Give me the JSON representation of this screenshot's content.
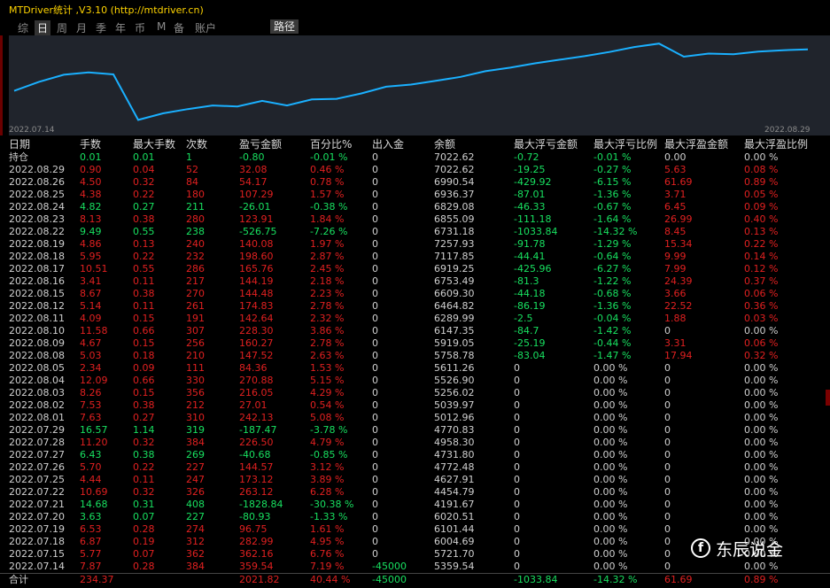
{
  "window": {
    "title": "MTDriver统计 ,V3.10 (http://mtdriver.cn)"
  },
  "tabs": [
    "综",
    "日",
    "周",
    "月",
    "季",
    "年",
    "币",
    "M",
    "备",
    "账户"
  ],
  "active_tab": "日",
  "path_button": "路径",
  "chart": {
    "x_start": "2022.07.14",
    "x_end": "2022.08.29",
    "line_color": "#1ab0ff",
    "balance": [
      5359.54,
      5721.7,
      6004.69,
      6101.44,
      6020.51,
      4191.67,
      4454.79,
      4627.91,
      4772.48,
      4731.8,
      4958.3,
      4770.83,
      5012.96,
      5039.97,
      5256.02,
      5526.9,
      5611.26,
      5758.78,
      5919.05,
      6147.35,
      6289.99,
      6464.82,
      6609.3,
      6753.49,
      6919.25,
      7117.85,
      7257.93,
      6731.18,
      6855.09,
      6829.08,
      6936.37,
      6990.54,
      7022.62
    ]
  },
  "columns": [
    "日期",
    "手数",
    "最大手数",
    "次数",
    "盈亏金额",
    "百分比%",
    "出入金",
    "余额",
    "最大浮亏金额",
    "最大浮亏比例",
    "最大浮盈金额",
    "最大浮盈比例"
  ],
  "holding": {
    "date": "持仓",
    "lots": "0.01",
    "max_lots": "0.01",
    "count": "1",
    "pnl": "-0.80",
    "pct": "-0.01 %",
    "flow": "0",
    "balance": "7022.62",
    "max_dd": "-0.72",
    "max_dd_pct": "-0.01 %",
    "max_fp": "0.00",
    "max_fp_pct": "0.00 %"
  },
  "rows": [
    {
      "date": "2022.08.29",
      "lots": "0.90",
      "max_lots": "0.04",
      "count": "52",
      "pnl": "32.08",
      "pct": "0.46 %",
      "flow": "0",
      "balance": "7022.62",
      "max_dd": "-19.25",
      "max_dd_pct": "-0.27 %",
      "max_fp": "5.63",
      "max_fp_pct": "0.08 %"
    },
    {
      "date": "2022.08.26",
      "lots": "4.50",
      "max_lots": "0.32",
      "count": "84",
      "pnl": "54.17",
      "pct": "0.78 %",
      "flow": "0",
      "balance": "6990.54",
      "max_dd": "-429.92",
      "max_dd_pct": "-6.15 %",
      "max_fp": "61.69",
      "max_fp_pct": "0.89 %"
    },
    {
      "date": "2022.08.25",
      "lots": "4.38",
      "max_lots": "0.22",
      "count": "180",
      "pnl": "107.29",
      "pct": "1.57 %",
      "flow": "0",
      "balance": "6936.37",
      "max_dd": "-87.01",
      "max_dd_pct": "-1.36 %",
      "max_fp": "3.71",
      "max_fp_pct": "0.05 %"
    },
    {
      "date": "2022.08.24",
      "lots": "4.82",
      "max_lots": "0.27",
      "count": "211",
      "pnl": "-26.01",
      "pct": "-0.38 %",
      "flow": "0",
      "balance": "6829.08",
      "max_dd": "-46.33",
      "max_dd_pct": "-0.67 %",
      "max_fp": "6.45",
      "max_fp_pct": "0.09 %"
    },
    {
      "date": "2022.08.23",
      "lots": "8.13",
      "max_lots": "0.38",
      "count": "280",
      "pnl": "123.91",
      "pct": "1.84 %",
      "flow": "0",
      "balance": "6855.09",
      "max_dd": "-111.18",
      "max_dd_pct": "-1.64 %",
      "max_fp": "26.99",
      "max_fp_pct": "0.40 %"
    },
    {
      "date": "2022.08.22",
      "lots": "9.49",
      "max_lots": "0.55",
      "count": "238",
      "pnl": "-526.75",
      "pct": "-7.26 %",
      "flow": "0",
      "balance": "6731.18",
      "max_dd": "-1033.84",
      "max_dd_pct": "-14.32 %",
      "max_fp": "8.45",
      "max_fp_pct": "0.13 %"
    },
    {
      "date": "2022.08.19",
      "lots": "4.86",
      "max_lots": "0.13",
      "count": "240",
      "pnl": "140.08",
      "pct": "1.97 %",
      "flow": "0",
      "balance": "7257.93",
      "max_dd": "-91.78",
      "max_dd_pct": "-1.29 %",
      "max_fp": "15.34",
      "max_fp_pct": "0.22 %"
    },
    {
      "date": "2022.08.18",
      "lots": "5.95",
      "max_lots": "0.22",
      "count": "232",
      "pnl": "198.60",
      "pct": "2.87 %",
      "flow": "0",
      "balance": "7117.85",
      "max_dd": "-44.41",
      "max_dd_pct": "-0.64 %",
      "max_fp": "9.99",
      "max_fp_pct": "0.14 %"
    },
    {
      "date": "2022.08.17",
      "lots": "10.51",
      "max_lots": "0.55",
      "count": "286",
      "pnl": "165.76",
      "pct": "2.45 %",
      "flow": "0",
      "balance": "6919.25",
      "max_dd": "-425.96",
      "max_dd_pct": "-6.27 %",
      "max_fp": "7.99",
      "max_fp_pct": "0.12 %"
    },
    {
      "date": "2022.08.16",
      "lots": "3.41",
      "max_lots": "0.11",
      "count": "217",
      "pnl": "144.19",
      "pct": "2.18 %",
      "flow": "0",
      "balance": "6753.49",
      "max_dd": "-81.3",
      "max_dd_pct": "-1.22 %",
      "max_fp": "24.39",
      "max_fp_pct": "0.37 %"
    },
    {
      "date": "2022.08.15",
      "lots": "8.67",
      "max_lots": "0.38",
      "count": "270",
      "pnl": "144.48",
      "pct": "2.23 %",
      "flow": "0",
      "balance": "6609.30",
      "max_dd": "-44.18",
      "max_dd_pct": "-0.68 %",
      "max_fp": "3.66",
      "max_fp_pct": "0.06 %"
    },
    {
      "date": "2022.08.12",
      "lots": "5.14",
      "max_lots": "0.11",
      "count": "261",
      "pnl": "174.83",
      "pct": "2.78 %",
      "flow": "0",
      "balance": "6464.82",
      "max_dd": "-86.19",
      "max_dd_pct": "-1.36 %",
      "max_fp": "22.52",
      "max_fp_pct": "0.36 %"
    },
    {
      "date": "2022.08.11",
      "lots": "4.09",
      "max_lots": "0.15",
      "count": "191",
      "pnl": "142.64",
      "pct": "2.32 %",
      "flow": "0",
      "balance": "6289.99",
      "max_dd": "-2.5",
      "max_dd_pct": "-0.04 %",
      "max_fp": "1.88",
      "max_fp_pct": "0.03 %"
    },
    {
      "date": "2022.08.10",
      "lots": "11.58",
      "max_lots": "0.66",
      "count": "307",
      "pnl": "228.30",
      "pct": "3.86 %",
      "flow": "0",
      "balance": "6147.35",
      "max_dd": "-84.7",
      "max_dd_pct": "-1.42 %",
      "max_fp": "0",
      "max_fp_pct": "0.00 %"
    },
    {
      "date": "2022.08.09",
      "lots": "4.67",
      "max_lots": "0.15",
      "count": "256",
      "pnl": "160.27",
      "pct": "2.78 %",
      "flow": "0",
      "balance": "5919.05",
      "max_dd": "-25.19",
      "max_dd_pct": "-0.44 %",
      "max_fp": "3.31",
      "max_fp_pct": "0.06 %"
    },
    {
      "date": "2022.08.08",
      "lots": "5.03",
      "max_lots": "0.18",
      "count": "210",
      "pnl": "147.52",
      "pct": "2.63 %",
      "flow": "0",
      "balance": "5758.78",
      "max_dd": "-83.04",
      "max_dd_pct": "-1.47 %",
      "max_fp": "17.94",
      "max_fp_pct": "0.32 %"
    },
    {
      "date": "2022.08.05",
      "lots": "2.34",
      "max_lots": "0.09",
      "count": "111",
      "pnl": "84.36",
      "pct": "1.53 %",
      "flow": "0",
      "balance": "5611.26",
      "max_dd": "0",
      "max_dd_pct": "0.00 %",
      "max_fp": "0",
      "max_fp_pct": "0.00 %"
    },
    {
      "date": "2022.08.04",
      "lots": "12.09",
      "max_lots": "0.66",
      "count": "330",
      "pnl": "270.88",
      "pct": "5.15 %",
      "flow": "0",
      "balance": "5526.90",
      "max_dd": "0",
      "max_dd_pct": "0.00 %",
      "max_fp": "0",
      "max_fp_pct": "0.00 %"
    },
    {
      "date": "2022.08.03",
      "lots": "8.26",
      "max_lots": "0.15",
      "count": "356",
      "pnl": "216.05",
      "pct": "4.29 %",
      "flow": "0",
      "balance": "5256.02",
      "max_dd": "0",
      "max_dd_pct": "0.00 %",
      "max_fp": "0",
      "max_fp_pct": "0.00 %"
    },
    {
      "date": "2022.08.02",
      "lots": "7.53",
      "max_lots": "0.38",
      "count": "212",
      "pnl": "27.01",
      "pct": "0.54 %",
      "flow": "0",
      "balance": "5039.97",
      "max_dd": "0",
      "max_dd_pct": "0.00 %",
      "max_fp": "0",
      "max_fp_pct": "0.00 %"
    },
    {
      "date": "2022.08.01",
      "lots": "7.63",
      "max_lots": "0.27",
      "count": "310",
      "pnl": "242.13",
      "pct": "5.08 %",
      "flow": "0",
      "balance": "5012.96",
      "max_dd": "0",
      "max_dd_pct": "0.00 %",
      "max_fp": "0",
      "max_fp_pct": "0.00 %"
    },
    {
      "date": "2022.07.29",
      "lots": "16.57",
      "max_lots": "1.14",
      "count": "319",
      "pnl": "-187.47",
      "pct": "-3.78 %",
      "flow": "0",
      "balance": "4770.83",
      "max_dd": "0",
      "max_dd_pct": "0.00 %",
      "max_fp": "0",
      "max_fp_pct": "0.00 %"
    },
    {
      "date": "2022.07.28",
      "lots": "11.20",
      "max_lots": "0.32",
      "count": "384",
      "pnl": "226.50",
      "pct": "4.79 %",
      "flow": "0",
      "balance": "4958.30",
      "max_dd": "0",
      "max_dd_pct": "0.00 %",
      "max_fp": "0",
      "max_fp_pct": "0.00 %"
    },
    {
      "date": "2022.07.27",
      "lots": "6.43",
      "max_lots": "0.38",
      "count": "269",
      "pnl": "-40.68",
      "pct": "-0.85 %",
      "flow": "0",
      "balance": "4731.80",
      "max_dd": "0",
      "max_dd_pct": "0.00 %",
      "max_fp": "0",
      "max_fp_pct": "0.00 %"
    },
    {
      "date": "2022.07.26",
      "lots": "5.70",
      "max_lots": "0.22",
      "count": "227",
      "pnl": "144.57",
      "pct": "3.12 %",
      "flow": "0",
      "balance": "4772.48",
      "max_dd": "0",
      "max_dd_pct": "0.00 %",
      "max_fp": "0",
      "max_fp_pct": "0.00 %"
    },
    {
      "date": "2022.07.25",
      "lots": "4.44",
      "max_lots": "0.11",
      "count": "247",
      "pnl": "173.12",
      "pct": "3.89 %",
      "flow": "0",
      "balance": "4627.91",
      "max_dd": "0",
      "max_dd_pct": "0.00 %",
      "max_fp": "0",
      "max_fp_pct": "0.00 %"
    },
    {
      "date": "2022.07.22",
      "lots": "10.69",
      "max_lots": "0.32",
      "count": "326",
      "pnl": "263.12",
      "pct": "6.28 %",
      "flow": "0",
      "balance": "4454.79",
      "max_dd": "0",
      "max_dd_pct": "0.00 %",
      "max_fp": "0",
      "max_fp_pct": "0.00 %"
    },
    {
      "date": "2022.07.21",
      "lots": "14.68",
      "max_lots": "0.31",
      "count": "408",
      "pnl": "-1828.84",
      "pct": "-30.38 %",
      "flow": "0",
      "balance": "4191.67",
      "max_dd": "0",
      "max_dd_pct": "0.00 %",
      "max_fp": "0",
      "max_fp_pct": "0.00 %"
    },
    {
      "date": "2022.07.20",
      "lots": "3.63",
      "max_lots": "0.07",
      "count": "227",
      "pnl": "-80.93",
      "pct": "-1.33 %",
      "flow": "0",
      "balance": "6020.51",
      "max_dd": "0",
      "max_dd_pct": "0.00 %",
      "max_fp": "0",
      "max_fp_pct": "0.00 %"
    },
    {
      "date": "2022.07.19",
      "lots": "6.53",
      "max_lots": "0.28",
      "count": "274",
      "pnl": "96.75",
      "pct": "1.61 %",
      "flow": "0",
      "balance": "6101.44",
      "max_dd": "0",
      "max_dd_pct": "0.00 %",
      "max_fp": "0",
      "max_fp_pct": "0.00 %"
    },
    {
      "date": "2022.07.18",
      "lots": "6.87",
      "max_lots": "0.19",
      "count": "312",
      "pnl": "282.99",
      "pct": "4.95 %",
      "flow": "0",
      "balance": "6004.69",
      "max_dd": "0",
      "max_dd_pct": "0.00 %",
      "max_fp": "0",
      "max_fp_pct": "0.00 %"
    },
    {
      "date": "2022.07.15",
      "lots": "5.77",
      "max_lots": "0.07",
      "count": "362",
      "pnl": "362.16",
      "pct": "6.76 %",
      "flow": "0",
      "balance": "5721.70",
      "max_dd": "0",
      "max_dd_pct": "0.00 %",
      "max_fp": "0",
      "max_fp_pct": "0.00 %"
    },
    {
      "date": "2022.07.14",
      "lots": "7.87",
      "max_lots": "0.28",
      "count": "384",
      "pnl": "359.54",
      "pct": "7.19 %",
      "flow": "-45000",
      "balance": "5359.54",
      "max_dd": "0",
      "max_dd_pct": "0.00 %",
      "max_fp": "0",
      "max_fp_pct": "0.00 %"
    }
  ],
  "total": {
    "date": "合计",
    "lots": "234.37",
    "max_lots": "",
    "count": "",
    "pnl": "2021.82",
    "pct": "40.44 %",
    "flow": "-45000",
    "balance": "",
    "max_dd": "-1033.84",
    "max_dd_pct": "-14.32 %",
    "max_fp": "61.69",
    "max_fp_pct": "0.89 %"
  },
  "watermark": {
    "text": "东辰说金"
  },
  "colors": {
    "positive": "#e02020",
    "negative": "#18e060",
    "title": "#ffd400",
    "chart_bg": "#20242c"
  }
}
